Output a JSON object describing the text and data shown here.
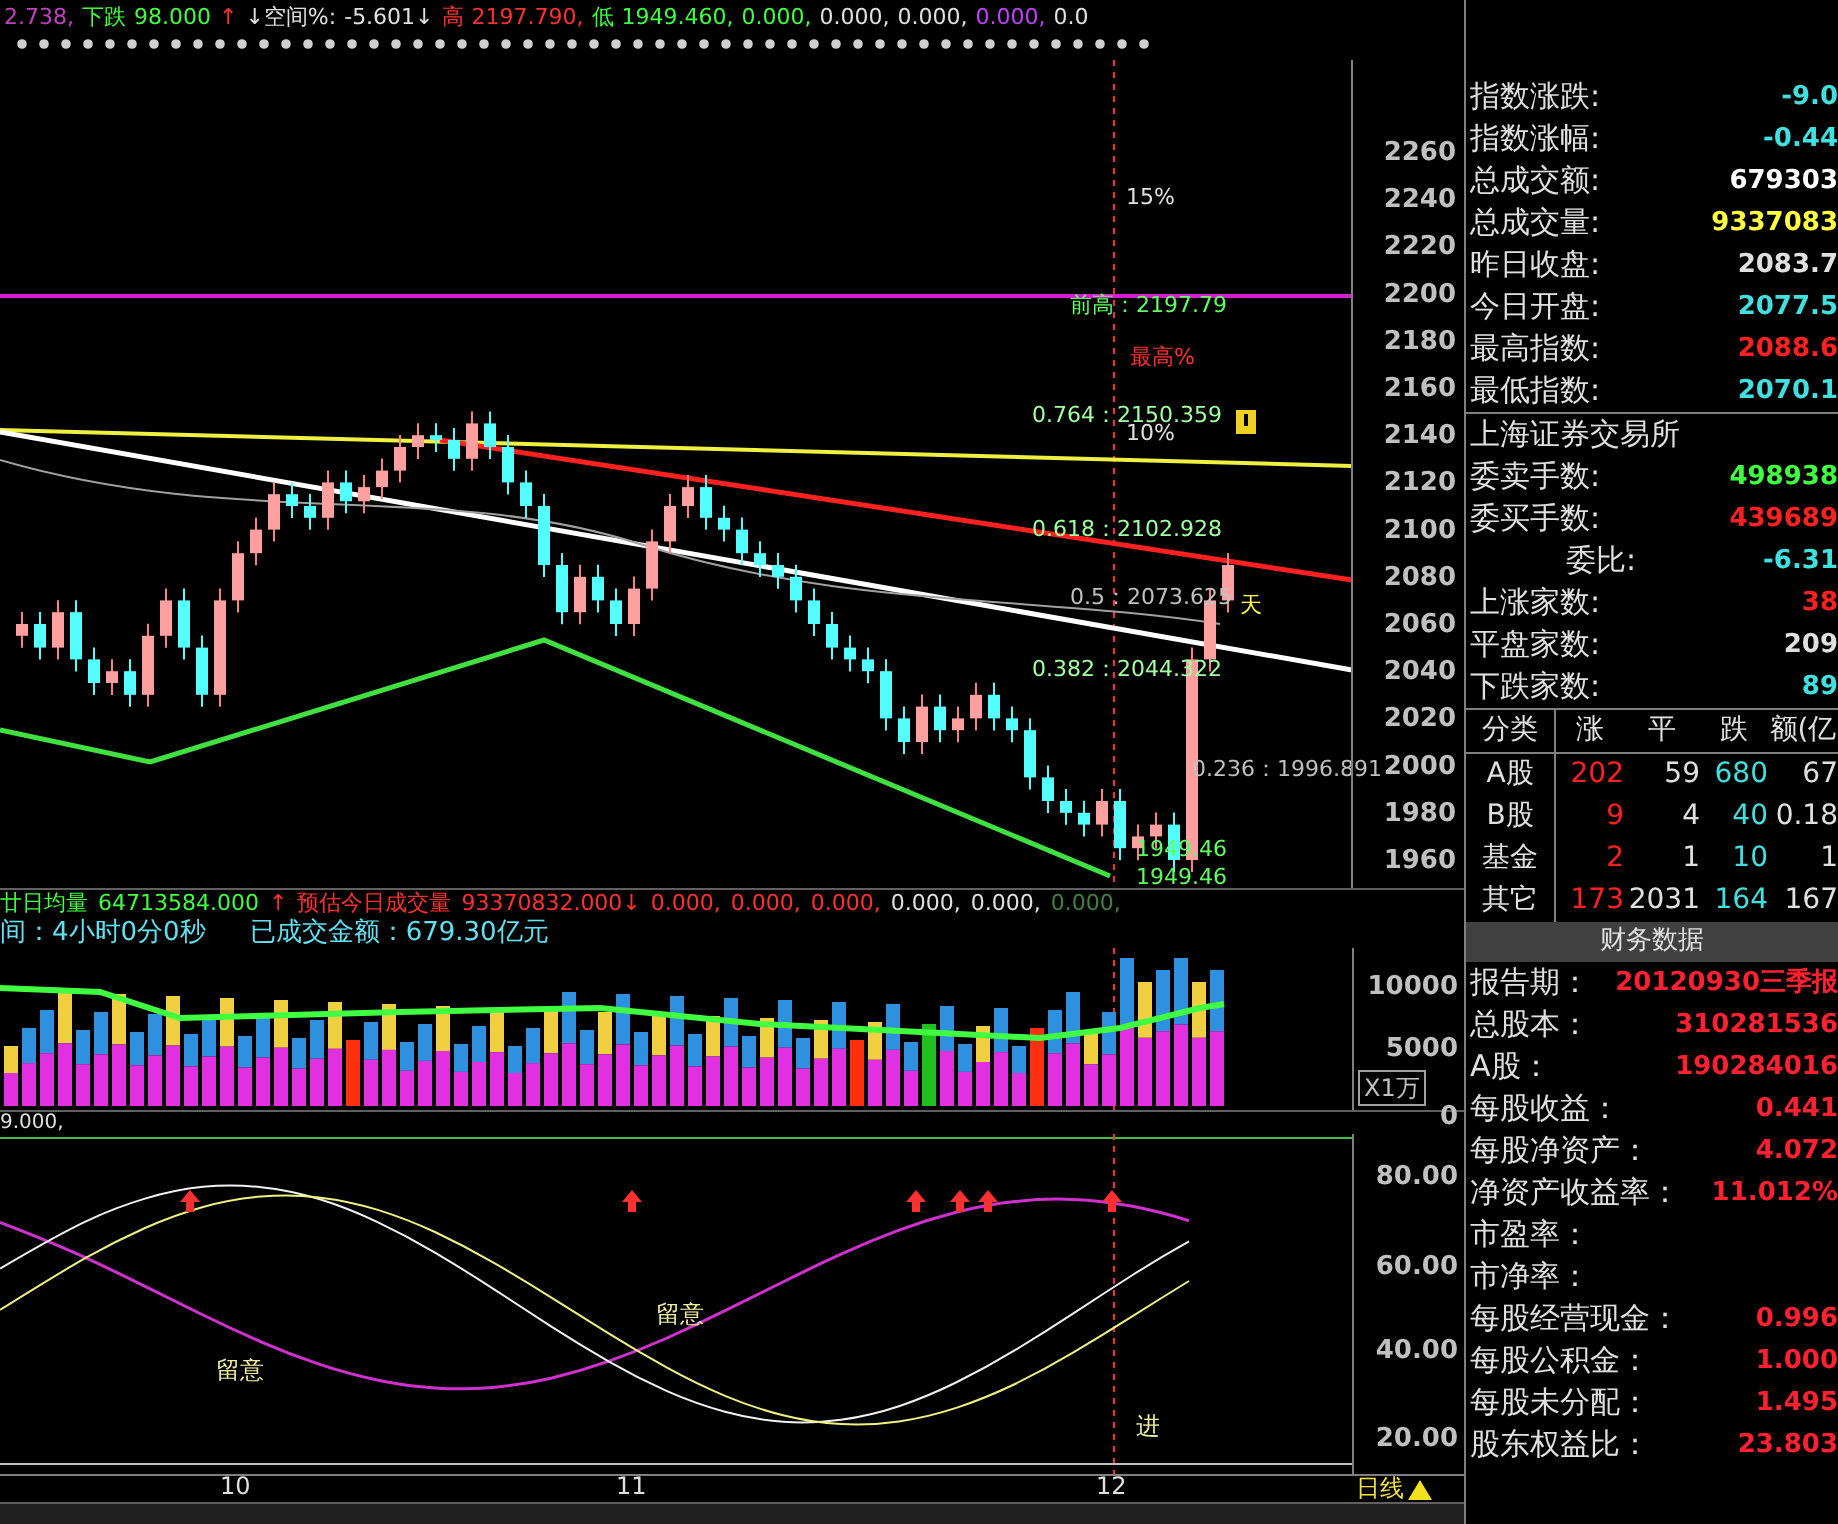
{
  "top_bar": {
    "items": [
      {
        "text": "2.738,",
        "color": "#c040c0"
      },
      {
        "text": "下跌",
        "color": "#40ff40"
      },
      {
        "text": "98.000",
        "color": "#40ff40"
      },
      {
        "text": "↑",
        "color": "#ff3030"
      },
      {
        "text": "↓空间%:",
        "color": "#e0e0e0"
      },
      {
        "text": "-5.601↓",
        "color": "#e0e0e0"
      },
      {
        "text": "高",
        "color": "#ff3030"
      },
      {
        "text": "2197.790,",
        "color": "#ff3030"
      },
      {
        "text": "低",
        "color": "#40ff40"
      },
      {
        "text": "1949.460,",
        "color": "#40ff40"
      },
      {
        "text": "0.000,",
        "color": "#40ff40"
      },
      {
        "text": "0.000,",
        "color": "#e0e0e0"
      },
      {
        "text": "0.000,",
        "color": "#e0e0e0"
      },
      {
        "text": "0.000,",
        "color": "#c040ff"
      },
      {
        "text": "0.0",
        "color": "#e0e0e0"
      }
    ]
  },
  "main_chart": {
    "price_ticks": [
      "2260",
      "2240",
      "2220",
      "2200",
      "2180",
      "2160",
      "2140",
      "2120",
      "2100",
      "2080",
      "2060",
      "2040",
      "2020",
      "2000",
      "1980",
      "1960"
    ],
    "annotations": [
      {
        "text": "15%",
        "color": "#e0e0e0"
      },
      {
        "text": "前高：2197.79",
        "color": "#60ff60"
      },
      {
        "text": "最高%",
        "color": "#ff3030"
      },
      {
        "text": "0.764：2150.359",
        "color": "#a0ffa0"
      },
      {
        "text": "10%",
        "color": "#e0e0e0"
      },
      {
        "text": "0.618：2102.928",
        "color": "#a0ffa0"
      },
      {
        "text": "0.5：2073.625",
        "color": "#c0c0c0"
      },
      {
        "text": "天",
        "color": "#ffff40"
      },
      {
        "text": "0.382：2044.322",
        "color": "#a0ffa0"
      },
      {
        "text": "0.236：1996.891",
        "color": "#c0c0c0"
      },
      {
        "text": "1949.46",
        "color": "#60ff60"
      },
      {
        "text": "1949.46",
        "color": "#60ff60"
      }
    ]
  },
  "volume": {
    "header": [
      {
        "text": "廿日均量",
        "color": "#40ff40"
      },
      {
        "text": "64713584.000",
        "color": "#40ff40"
      },
      {
        "text": "↑",
        "color": "#ff3030"
      },
      {
        "text": "预估今日成交量",
        "color": "#ff3030"
      },
      {
        "text": "93370832.000↓",
        "color": "#ff3030"
      },
      {
        "text": "0.000,",
        "color": "#ff3030"
      },
      {
        "text": "0.000,",
        "color": "#ff3030"
      },
      {
        "text": "0.000,",
        "color": "#ff3030"
      },
      {
        "text": "0.000,",
        "color": "#e0e0e0"
      },
      {
        "text": "0.000,",
        "color": "#e0e0e0"
      },
      {
        "text": "0.000,",
        "color": "#408040"
      }
    ],
    "info": [
      "间：4小时0分0秒",
      "已成交金额：679.30亿元"
    ],
    "ticks": [
      "10000",
      "5000",
      "0"
    ],
    "unit": "X1万"
  },
  "oscillator": {
    "header": "9.000,",
    "ticks": [
      "80.00",
      "60.00",
      "40.00",
      "20.00"
    ],
    "labels": [
      "留意",
      "留意",
      "进"
    ]
  },
  "date_axis": {
    "labels": [
      "10",
      "11",
      "12"
    ],
    "period": "日线"
  },
  "quote_panel": {
    "rows": [
      {
        "label": "指数涨跌:",
        "value": "-9.0",
        "color": "#40e0e0"
      },
      {
        "label": "指数涨幅:",
        "value": "-0.44",
        "color": "#40e0e0"
      },
      {
        "label": "总成交额:",
        "value": "679303",
        "color": "#ffffff"
      },
      {
        "label": "总成交量:",
        "value": "9337083",
        "color": "#ffff40"
      },
      {
        "label": "昨日收盘:",
        "value": "2083.7",
        "color": "#e0e0e0"
      },
      {
        "label": "今日开盘:",
        "value": "2077.5",
        "color": "#40e0e0"
      },
      {
        "label": "最高指数:",
        "value": "2088.6",
        "color": "#ff2020"
      },
      {
        "label": "最低指数:",
        "value": "2070.1",
        "color": "#40e0e0"
      }
    ],
    "exchange": "上海证券交易所",
    "rows2": [
      {
        "label": "委卖手数:",
        "value": "498938",
        "color": "#40ff40"
      },
      {
        "label": "委买手数:",
        "value": "439689",
        "color": "#ff2020"
      },
      {
        "label": "委比:",
        "value": "-6.31",
        "color": "#40e0e0"
      },
      {
        "label": "上涨家数:",
        "value": "38",
        "color": "#ff2020"
      },
      {
        "label": "平盘家数:",
        "value": "209",
        "color": "#e0e0e0"
      },
      {
        "label": "下跌家数:",
        "value": "89",
        "color": "#40e0e0"
      }
    ]
  },
  "breadth_table": {
    "columns": [
      "分类",
      "涨",
      "平",
      "跌",
      "额(亿"
    ],
    "rows": [
      {
        "cells": [
          "A股",
          "202",
          "59",
          "680",
          "67"
        ]
      },
      {
        "cells": [
          "B股",
          "9",
          "4",
          "40",
          "0.18"
        ]
      },
      {
        "cells": [
          "基金",
          "2",
          "1",
          "10",
          "1"
        ]
      },
      {
        "cells": [
          "其它",
          "173",
          "2031",
          "164",
          "167"
        ]
      }
    ]
  },
  "finance": {
    "title": "财务数据",
    "rows": [
      {
        "label": "报告期：",
        "value": "20120930三季报"
      },
      {
        "label": "总股本：",
        "value": "310281536"
      },
      {
        "label": "A股：",
        "value": "190284016"
      },
      {
        "label": "每股收益：",
        "value": "0.441"
      },
      {
        "label": "每股净资产：",
        "value": "4.072"
      },
      {
        "label": "净资产收益率：",
        "value": "11.012%"
      },
      {
        "label": "市盈率："
      },
      {
        "label": "市净率："
      },
      {
        "label": "每股经营现金：",
        "value": "0.996"
      },
      {
        "label": "每股公积金：",
        "value": "1.000"
      },
      {
        "label": "每股未分配：",
        "value": "1.495"
      },
      {
        "label": "股东权益比：",
        "value": "23.803"
      }
    ]
  }
}
